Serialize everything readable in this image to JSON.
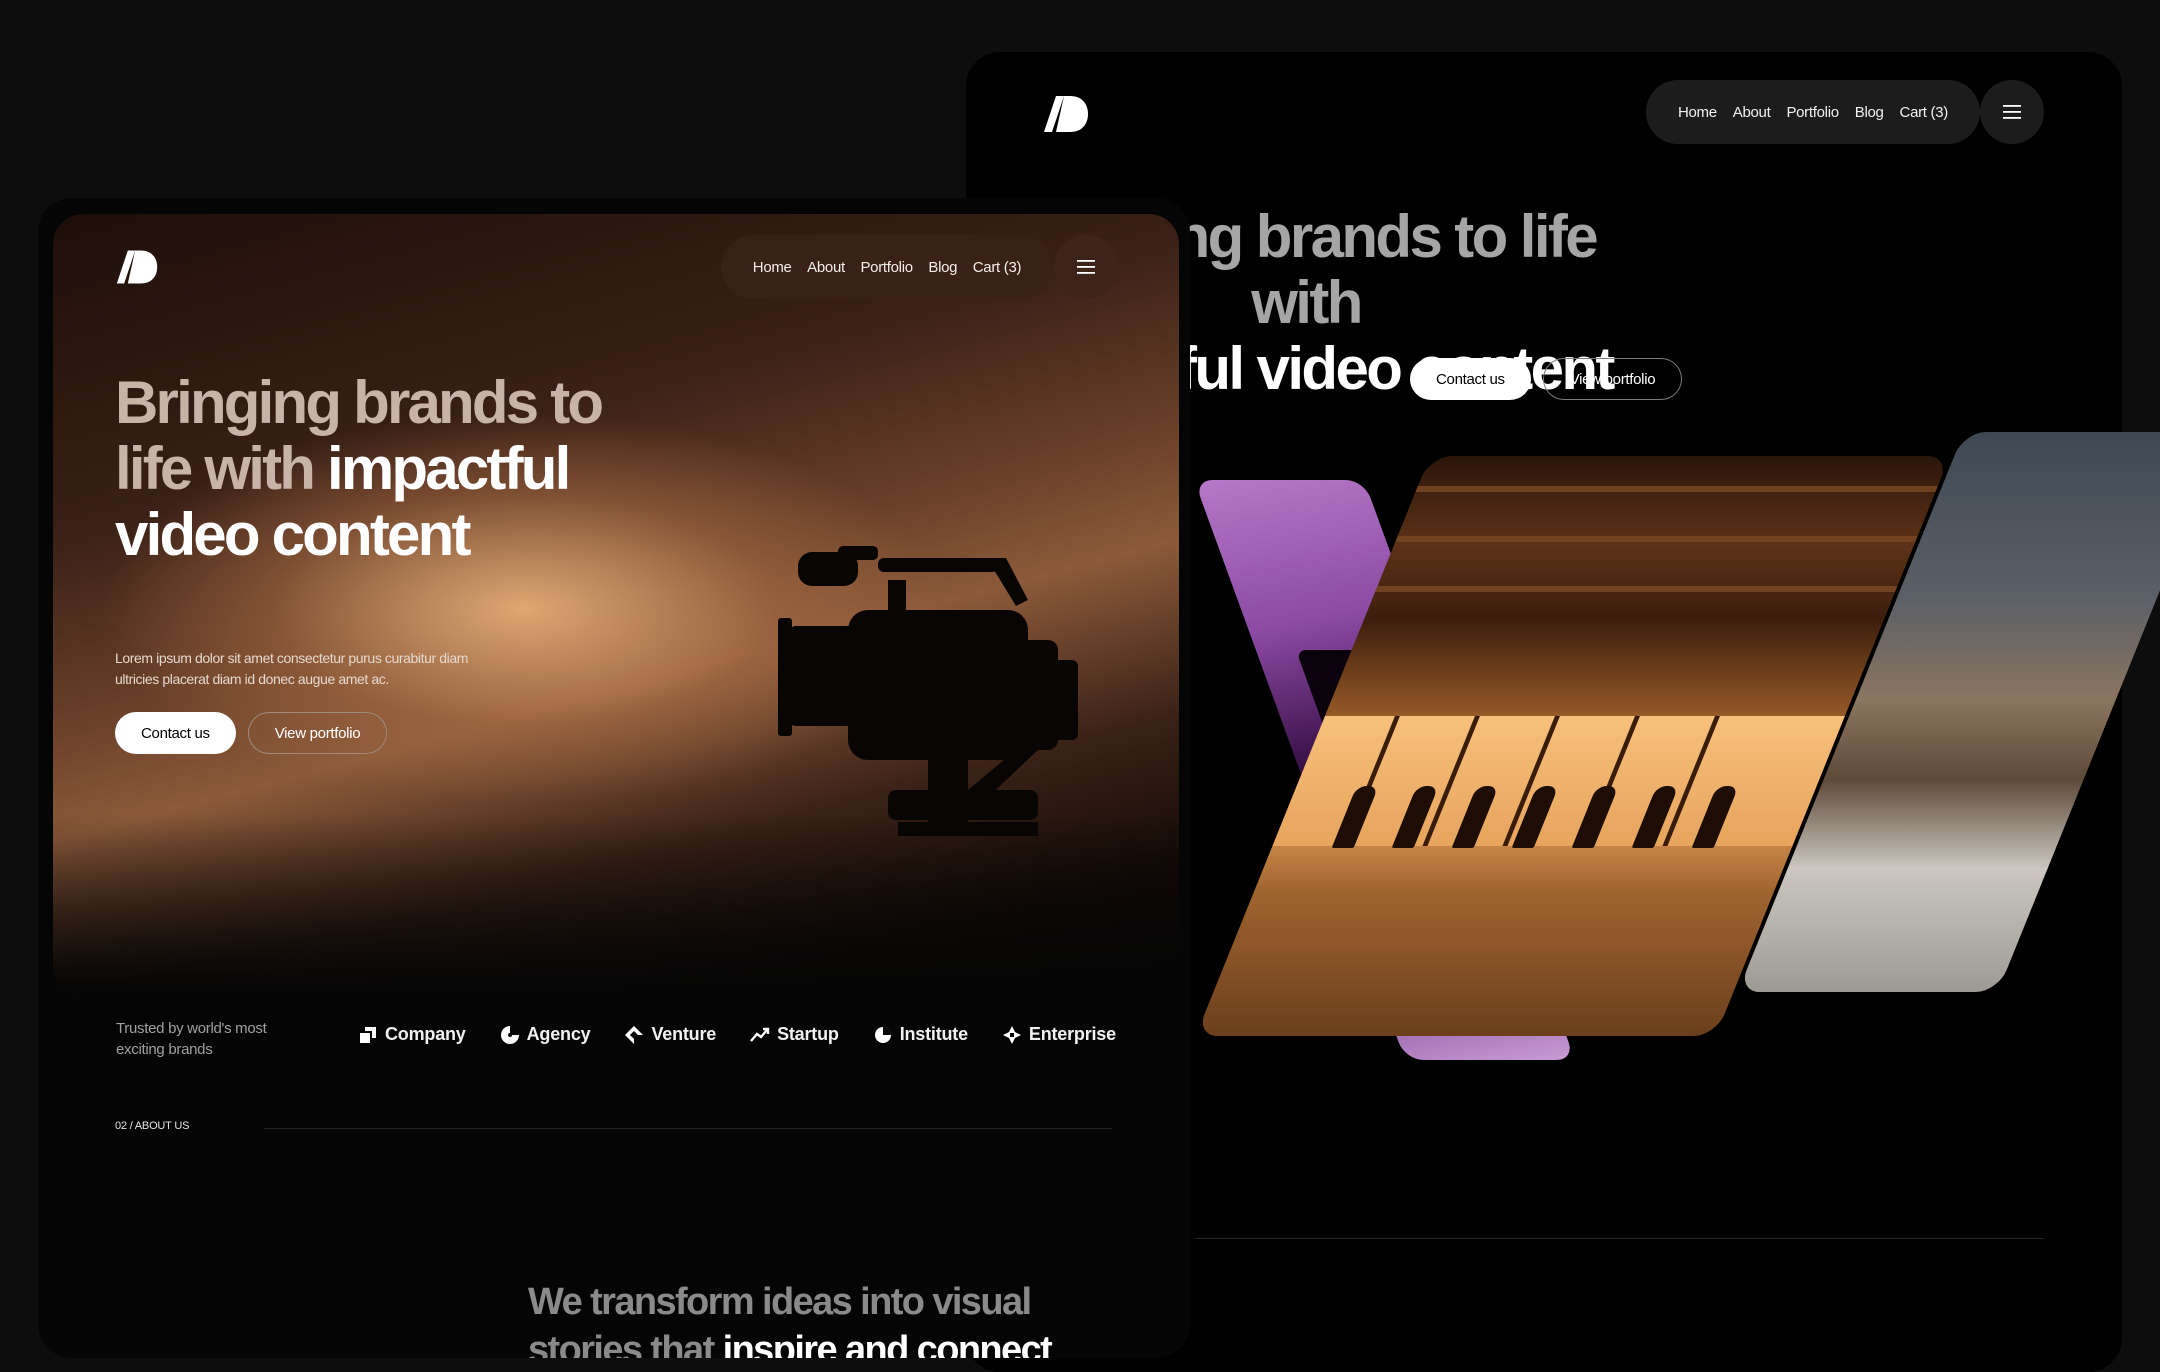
{
  "back_page": {
    "nav": [
      "Home",
      "About",
      "Portfolio",
      "Blog",
      "Cart (3)"
    ],
    "headline_dim": "Bringing brands to life with",
    "headline_bright": "impactful video content",
    "primary_cta": "Contact us",
    "secondary_cta": "View portfolio"
  },
  "front_page": {
    "nav": [
      "Home",
      "About",
      "Portfolio",
      "Blog",
      "Cart (3)"
    ],
    "headline_dim": "Bringing brands to life with",
    "headline_bright": "impactful video content",
    "description": "Lorem ipsum dolor sit amet consectetur purus curabitur diam ultricies placerat diam id donec augue amet ac.",
    "primary_cta": "Contact us",
    "secondary_cta": "View portfolio",
    "trusted": "Trusted by world's most exciting brands",
    "brands": [
      {
        "name": "Company",
        "icon": "company-logo-icon"
      },
      {
        "name": "Agency",
        "icon": "agency-logo-icon"
      },
      {
        "name": "Venture",
        "icon": "venture-logo-icon"
      },
      {
        "name": "Startup",
        "icon": "startup-logo-icon"
      },
      {
        "name": "Institute",
        "icon": "institute-logo-icon"
      },
      {
        "name": "Enterprise",
        "icon": "enterprise-logo-icon"
      }
    ],
    "section_tag": "02 / ABOUT US",
    "about_dim": "We transform ideas into visual stories that",
    "about_bright": "inspire and connect"
  }
}
